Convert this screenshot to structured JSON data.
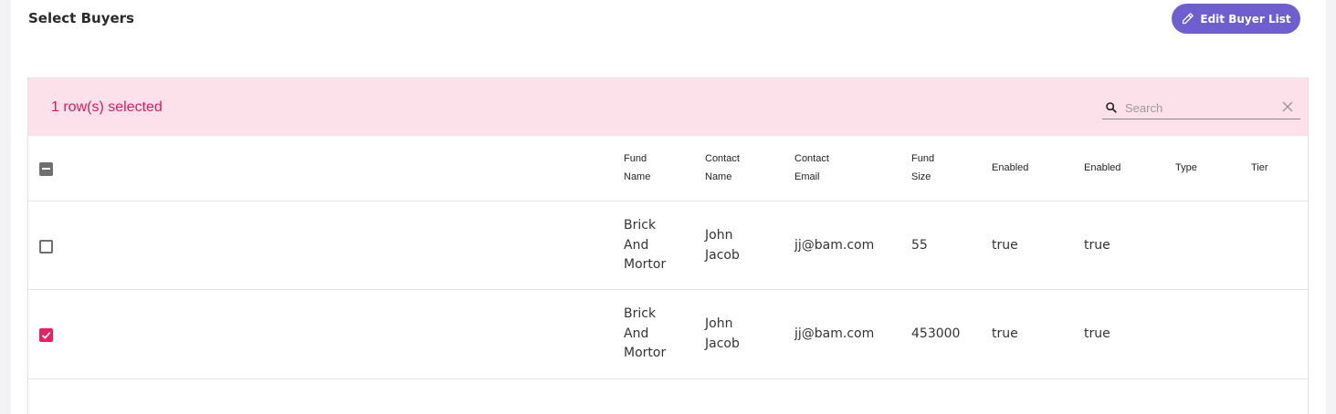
{
  "header": {
    "title": "Select Buyers",
    "edit_button_label": "Edit Buyer List"
  },
  "selection": {
    "text": "1 row(s) selected"
  },
  "search": {
    "placeholder": "Search",
    "value": ""
  },
  "table": {
    "columns": [
      {
        "line1": "Fund",
        "line2": "Name"
      },
      {
        "line1": "Contact",
        "line2": "Name"
      },
      {
        "line1": "Contact",
        "line2": "Email"
      },
      {
        "line1": "Fund",
        "line2": "Size"
      },
      {
        "line1": "Enabled"
      },
      {
        "line1": "Enabled"
      },
      {
        "line1": "Type"
      },
      {
        "line1": "Tier"
      }
    ],
    "rows": [
      {
        "checked": false,
        "fund_name": [
          "Brick",
          "And",
          "Mortor"
        ],
        "contact_name": [
          "John",
          "Jacob"
        ],
        "contact_email": "jj@bam.com",
        "fund_size": "55",
        "enabled_1": "true",
        "enabled_2": "true",
        "type": "",
        "tier": ""
      },
      {
        "checked": true,
        "fund_name": [
          "Brick",
          "And",
          "Mortor"
        ],
        "contact_name": [
          "John",
          "Jacob"
        ],
        "contact_email": "jj@bam.com",
        "fund_size": "453000",
        "enabled_1": "true",
        "enabled_2": "true",
        "type": "",
        "tier": ""
      }
    ]
  },
  "colors": {
    "accent_purple": "#6e5fd0",
    "selection_bg": "#fde1ea",
    "selection_text": "#d81b60",
    "checkbox_checked": "#e91e63"
  },
  "icons": {
    "edit_button": "pencil-icon",
    "search": "search-icon",
    "clear": "close-icon"
  }
}
